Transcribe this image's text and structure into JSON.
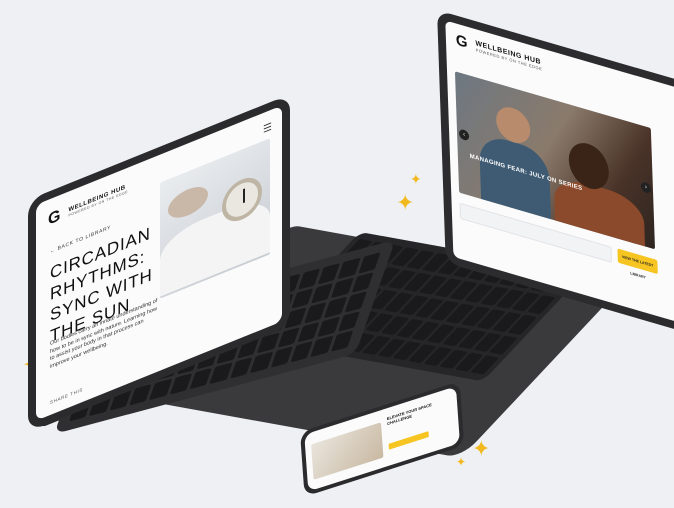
{
  "brand": {
    "logo": "G",
    "hub_title": "WELLBEING HUB",
    "hub_subtitle": "POWERED BY ON THE EDGE"
  },
  "laptop": {
    "hero_caption": "MANAGING FEAR: JULY ON SERIES",
    "prev_arrow": "‹",
    "next_arrow": "›",
    "cta_label": "VIEW THE LATEST LIBRARY"
  },
  "tablet": {
    "menu_icon": "☰",
    "back_link": "← BACK TO LIBRARY",
    "article_title": "CIRCADIAN RHYTHMS: SYNC WITH THE SUN",
    "article_body": "Our bodies carry an innate understanding of how to be in sync with nature. Learning how to assist your body in that process can improve your wellbeing.",
    "share_label": "SHARE THIS"
  },
  "phone": {
    "card_title": "ELEVATE YOUR SPACE CHALLENGE"
  },
  "colors": {
    "accent": "#f6c521",
    "sparkle": "#f2b91f",
    "device": "#2b2b2d",
    "background": "#eef0f3"
  }
}
